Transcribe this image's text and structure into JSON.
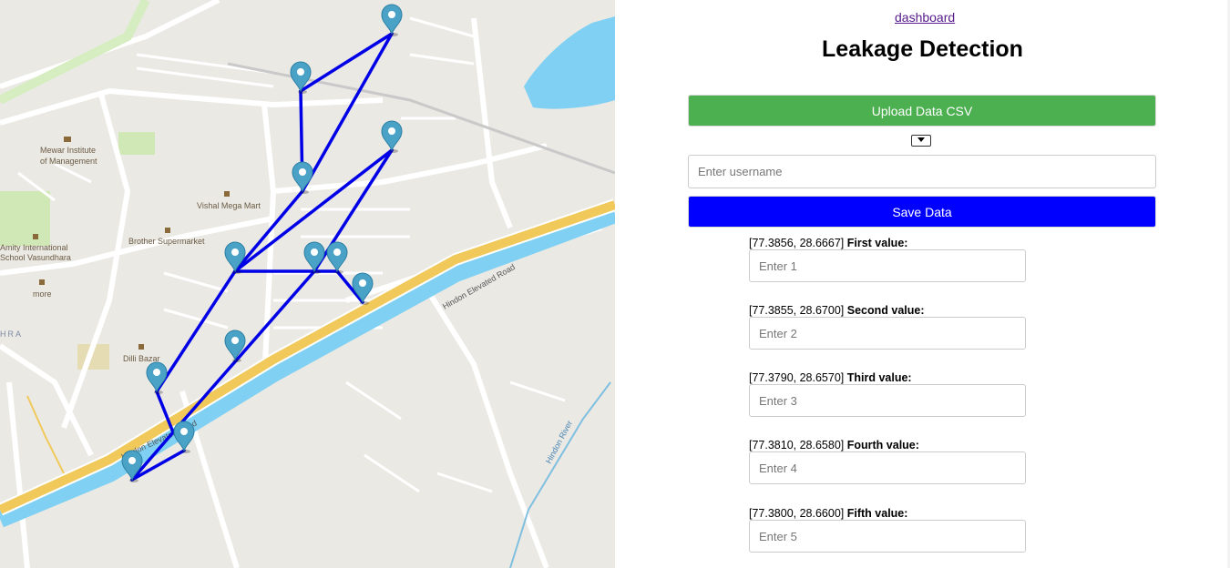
{
  "nav": {
    "dashboard_link": "dashboard"
  },
  "page": {
    "title": "Leakage Detection"
  },
  "actions": {
    "upload_label": "Upload Data CSV",
    "username_placeholder": "Enter username",
    "save_label": "Save Data"
  },
  "fields": [
    {
      "coords": "[77.3856, 28.6667]",
      "name": "First value:",
      "placeholder": "Enter 1"
    },
    {
      "coords": "[77.3855, 28.6700]",
      "name": "Second value:",
      "placeholder": "Enter 2"
    },
    {
      "coords": "[77.3790, 28.6570]",
      "name": "Third value:",
      "placeholder": "Enter 3"
    },
    {
      "coords": "[77.3810, 28.6580]",
      "name": "Fourth value:",
      "placeholder": "Enter 4"
    },
    {
      "coords": "[77.3800, 28.6600]",
      "name": "Fifth value:",
      "placeholder": "Enter 5"
    }
  ],
  "map": {
    "labels": {
      "mewar1": "Mewar Institute",
      "mewar2": "of Management",
      "vishal": "Vishal Mega Mart",
      "brother": "Brother Supermarket",
      "amity1": "Amity International",
      "amity2": "School Vasundhara",
      "more": "more",
      "hra": "HRA",
      "dilli": "Dilli Bazar",
      "hindon_road_upper": "Hindon Elevated Road",
      "hindon_road_lower": "Hindon Elevated Road",
      "hindon_river": "Hindon River"
    },
    "colors": {
      "pipeline": "#0000e6",
      "marker": "#4aa3c7",
      "road_major": "#f0c95a",
      "water": "#7fd0f2",
      "park": "#cfe8b5"
    },
    "marker_icon": "map-pin-icon"
  }
}
